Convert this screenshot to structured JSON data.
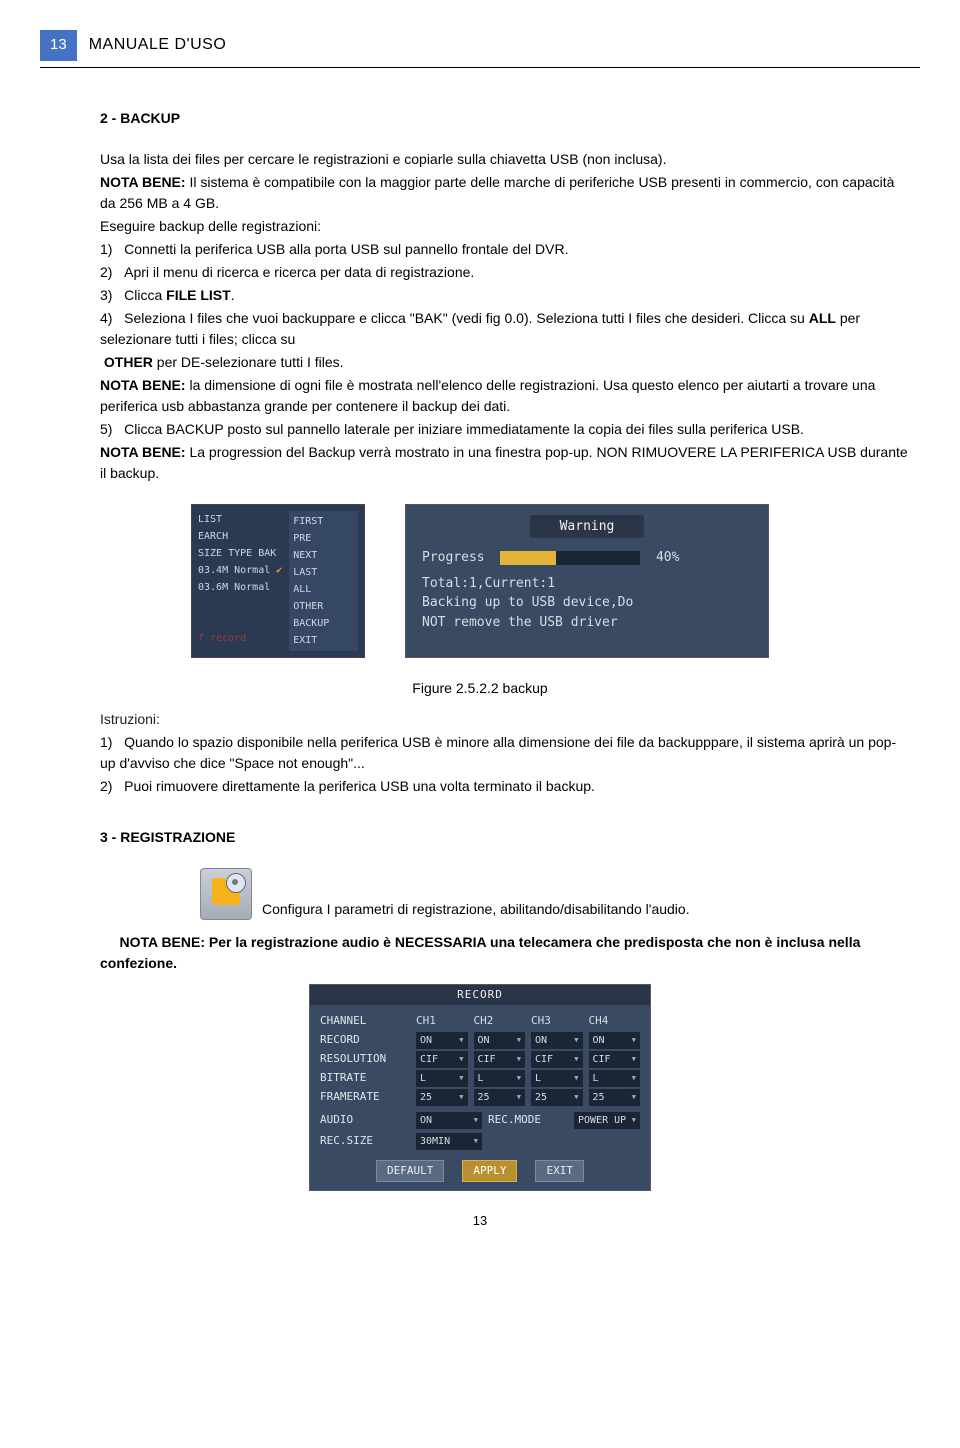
{
  "header": {
    "page_box": "13",
    "title": "MANUALE D'USO"
  },
  "section2": {
    "heading": "2 - BACKUP",
    "intro": "Usa la lista dei files per cercare le registrazioni e copiarle sulla chiavetta USB (non inclusa).",
    "nota1_prefix": "NOTA BENE:",
    "nota1_rest": " Il sistema è compatibile con la maggior parte delle marche di periferiche USB presenti in commercio, con capacità da 256 MB a 4 GB.",
    "eseg": "Eseguire backup delle registrazioni:",
    "li1_num": "1)",
    "li1": "Connetti la periferica USB alla porta USB sul pannello frontale del DVR.",
    "li2_num": "2)",
    "li2": "Apri il menu di ricerca e ricerca per data di registrazione.",
    "li3_num": "3)",
    "li3_a": "Clicca ",
    "li3_b": "FILE LIST",
    "li3_c": ".",
    "li4_num": "4)",
    "li4_a": "Seleziona I files che vuoi backuppare e clicca \"BAK\" (vedi fig 0.0). Seleziona tutti I files che desideri. Clicca su ",
    "li4_b": "ALL",
    "li4_c": " per selezionare tutti i files; clicca su",
    "li4_other": "OTHER",
    "li4_d": " per DE-selezionare tutti I files.",
    "nota2_prefix": "NOTA BENE:",
    "nota2_rest": " la dimensione di ogni file è mostrata nell'elenco delle registrazioni. Usa questo elenco per aiutarti a trovare una periferica usb abbastanza grande per contenere il backup dei dati.",
    "li5_num": "5)",
    "li5": "Clicca BACKUP posto sul pannello laterale per iniziare immediatamente la copia dei files sulla periferica USB.",
    "nota3_prefix": "NOTA BENE:",
    "nota3_rest": " La progression del Backup verrà mostrato in una finestra pop-up. NON RIMUOVERE LA PERIFERICA USB durante il backup."
  },
  "fig_left": {
    "h_list": "LIST",
    "h_search": "EARCH",
    "h_cols": "SIZE TYPE BAK",
    "r1": "03.4M Normal",
    "r2": "03.6M Normal",
    "foot": "f record",
    "menu": [
      "FIRST",
      "PRE",
      "NEXT",
      "LAST",
      "ALL",
      "OTHER",
      "BACKUP",
      "EXIT"
    ]
  },
  "fig_right": {
    "title": "Warning",
    "progress_label": "Progress",
    "progress_pct": "40%",
    "line_total": "Total:1,Current:1",
    "line_back": "Backing up to USB device,Do",
    "line_not": "NOT remove the USB driver"
  },
  "fig_caption": "Figure 2.5.2.2 backup",
  "istruzioni": {
    "label": "Istruzioni:",
    "i1_num": "1)",
    "i1": "Quando lo spazio disponibile nella periferica USB è minore alla dimensione dei file da backupppare, il sistema aprirà un pop-up d'avviso che dice \"Space not enough\"...",
    "i2_num": "2)",
    "i2": "Puoi rimuovere direttamente la periferica USB una volta terminato il backup."
  },
  "section3": {
    "heading": "3 - REGISTRAZIONE",
    "config": "Configura I parametri di registrazione, abilitando/disabilitando l'audio.",
    "nota_prefix": "NOTA BENE:",
    "nota_rest": " Per la registrazione audio è NECESSARIA una telecamera che predisposta che non è inclusa nella confezione."
  },
  "record_panel": {
    "title": "RECORD",
    "rows_label": [
      "CHANNEL",
      "RECORD",
      "RESOLUTION",
      "BITRATE",
      "FRAMERATE"
    ],
    "ch_headers": [
      "CH1",
      "CH2",
      "CH3",
      "CH4"
    ],
    "record_vals": [
      "ON",
      "ON",
      "ON",
      "ON"
    ],
    "resolution_vals": [
      "CIF",
      "CIF",
      "CIF",
      "CIF"
    ],
    "bitrate_vals": [
      "L",
      "L",
      "L",
      "L"
    ],
    "framerate_vals": [
      "25",
      "25",
      "25",
      "25"
    ],
    "audio_label": "AUDIO",
    "audio_val": "ON",
    "recmode_label": "REC.MODE",
    "recmode_val": "POWER UP",
    "recsize_label": "REC.SIZE",
    "recsize_val": "30MIN",
    "btn_default": "DEFAULT",
    "btn_apply": "APPLY",
    "btn_exit": "EXIT"
  },
  "footer_page": "13"
}
